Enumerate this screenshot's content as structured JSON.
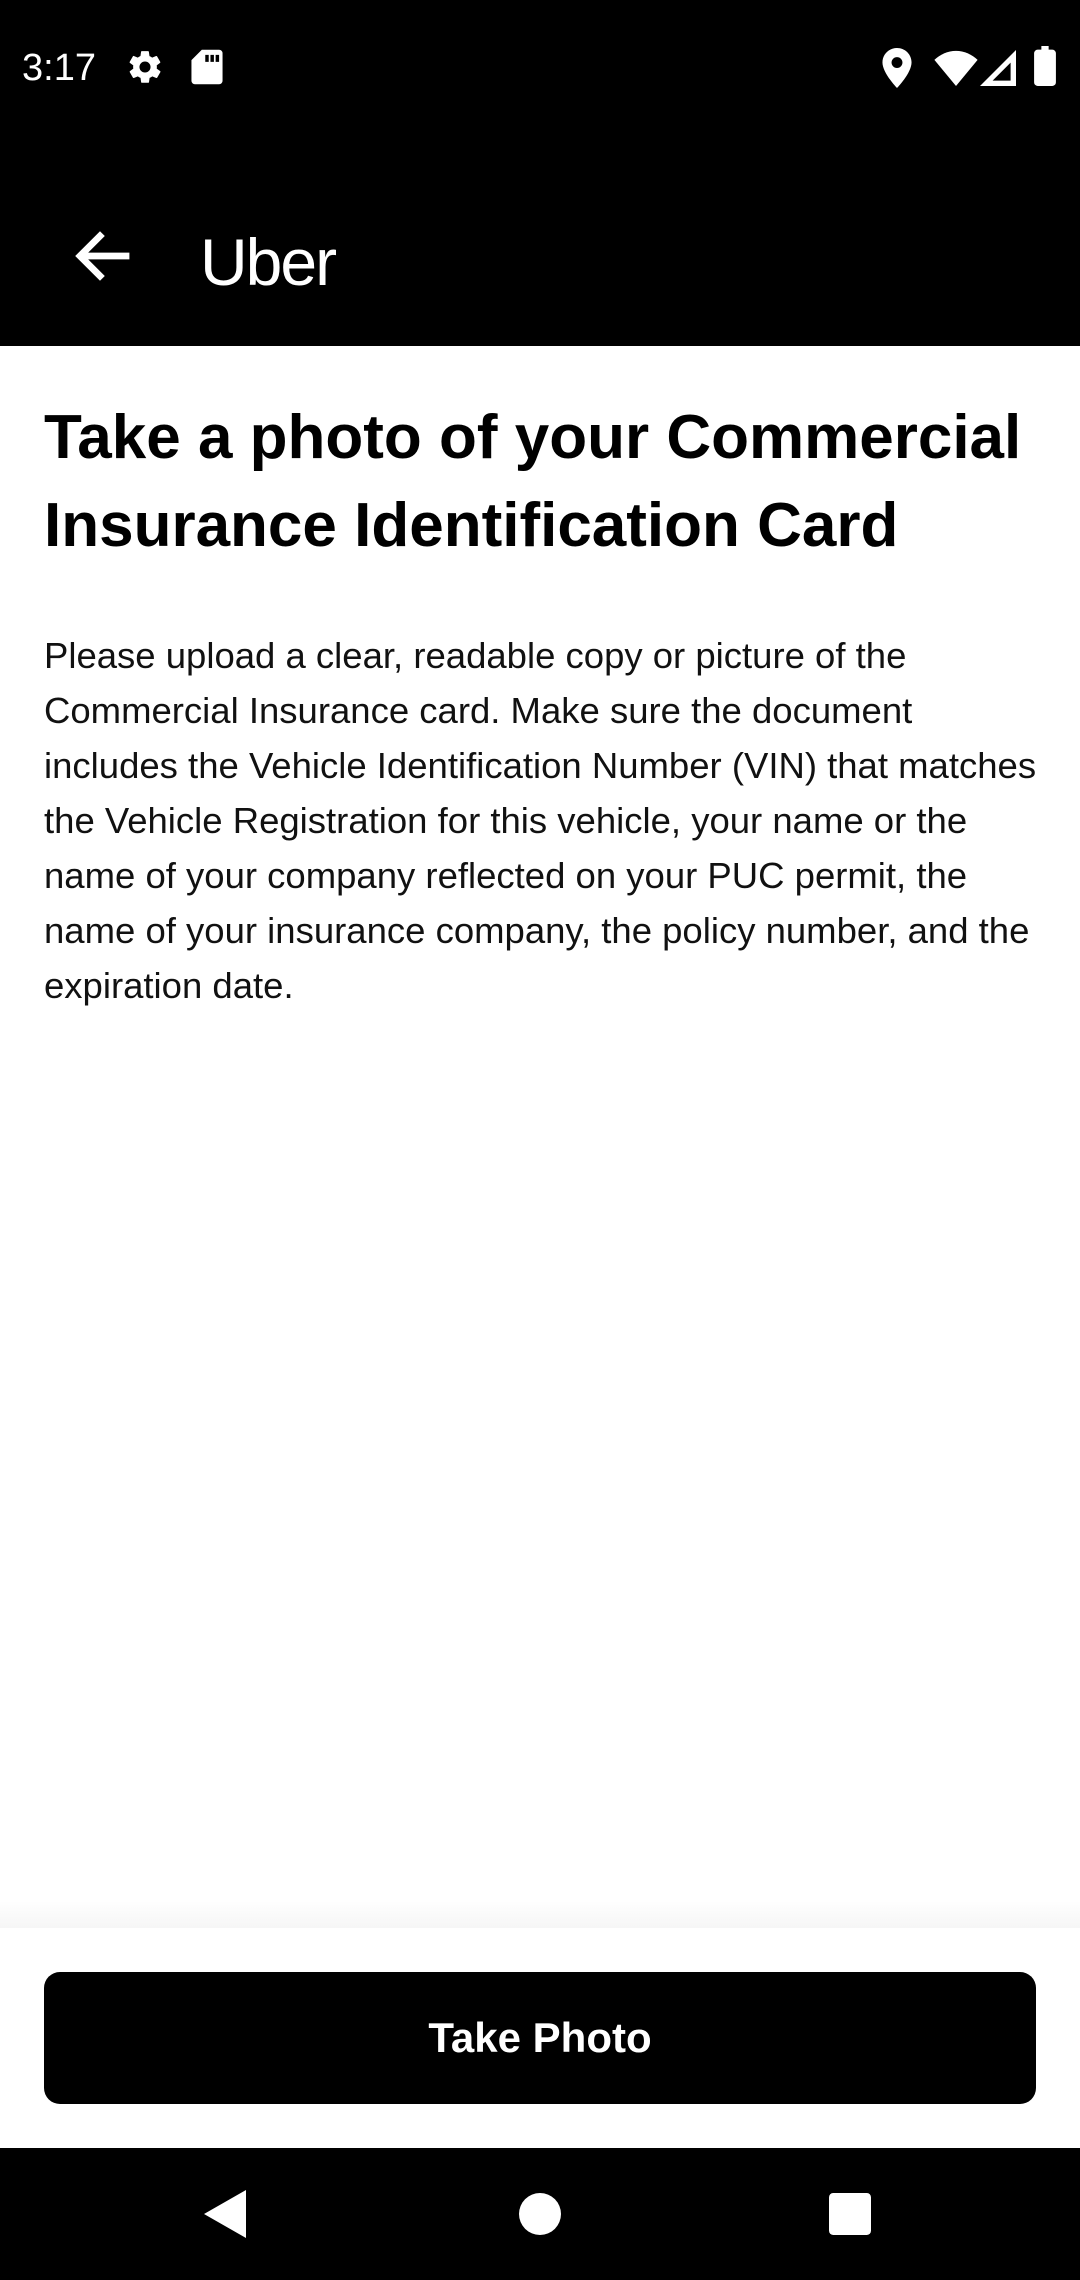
{
  "status_bar": {
    "time": "3:17",
    "left_icons": [
      "gear-icon",
      "sd-card-icon"
    ],
    "right_icons": [
      "location-icon",
      "wifi-icon",
      "signal-icon",
      "battery-icon"
    ]
  },
  "app_bar": {
    "back_icon": "arrow-back-icon",
    "title": "Uber"
  },
  "main": {
    "title": "Take a photo of your Commercial Insurance Identification Card",
    "description": "Please upload a clear, readable copy or picture of the Commercial Insurance card. Make sure the document includes the Vehicle Identification Number (VIN) that matches the Vehicle Registration for this vehicle, your name or the name of your company reflected on your PUC permit, the name of your insurance company, the policy number, and the expiration date."
  },
  "footer": {
    "button_label": "Take Photo"
  },
  "nav_bar": {
    "icons": [
      "nav-back-icon",
      "nav-home-icon",
      "nav-recents-icon"
    ]
  },
  "colors": {
    "bar_background": "#000000",
    "page_background": "#ffffff",
    "button_background": "#000000",
    "button_text": "#ffffff"
  }
}
